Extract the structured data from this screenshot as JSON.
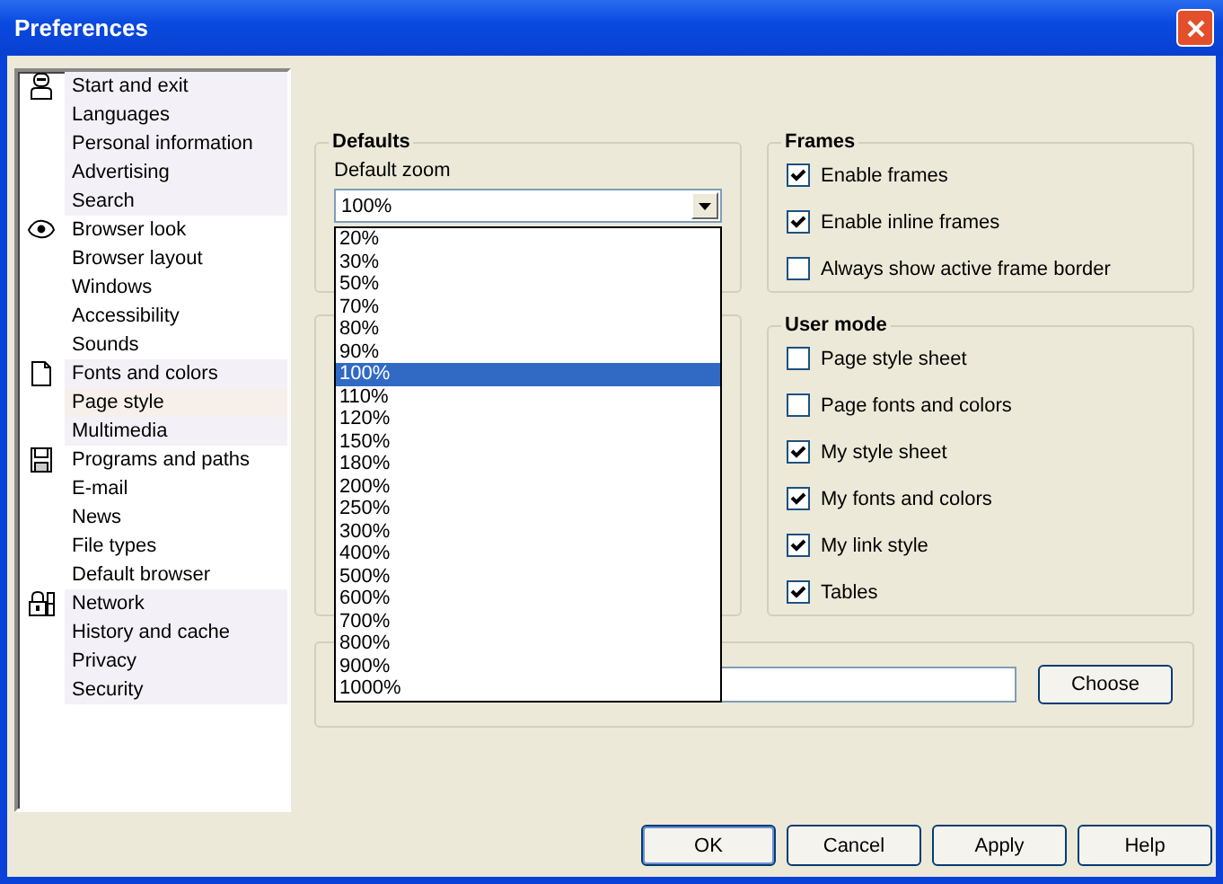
{
  "window": {
    "title": "Preferences"
  },
  "sidebar": {
    "groups": [
      {
        "items": [
          {
            "label": "Start and exit",
            "selected": false
          },
          {
            "label": "Languages",
            "selected": false
          },
          {
            "label": "Personal information",
            "selected": false
          },
          {
            "label": "Advertising",
            "selected": false
          },
          {
            "label": "Search",
            "selected": false
          }
        ]
      },
      {
        "items": [
          {
            "label": "Browser look",
            "selected": false
          },
          {
            "label": "Browser layout",
            "selected": false
          },
          {
            "label": "Windows",
            "selected": false
          },
          {
            "label": "Accessibility",
            "selected": false
          },
          {
            "label": "Sounds",
            "selected": false
          }
        ]
      },
      {
        "items": [
          {
            "label": "Fonts and colors",
            "selected": false
          },
          {
            "label": "Page style",
            "selected": true
          },
          {
            "label": "Multimedia",
            "selected": false
          }
        ]
      },
      {
        "items": [
          {
            "label": "Programs and paths",
            "selected": false
          },
          {
            "label": "E-mail",
            "selected": false
          },
          {
            "label": "News",
            "selected": false
          },
          {
            "label": "File types",
            "selected": false
          },
          {
            "label": "Default browser",
            "selected": false
          }
        ]
      },
      {
        "items": [
          {
            "label": "Network",
            "selected": false
          },
          {
            "label": "History and cache",
            "selected": false
          },
          {
            "label": "Privacy",
            "selected": false
          },
          {
            "label": "Security",
            "selected": false
          }
        ]
      }
    ]
  },
  "defaults": {
    "title": "Defaults",
    "zoom_label": "Default zoom",
    "zoom_value": "100%",
    "expanded": true,
    "options": [
      {
        "label": "20%",
        "selected": false
      },
      {
        "label": "30%",
        "selected": false
      },
      {
        "label": "50%",
        "selected": false
      },
      {
        "label": "70%",
        "selected": false
      },
      {
        "label": "80%",
        "selected": false
      },
      {
        "label": "90%",
        "selected": false
      },
      {
        "label": "100%",
        "selected": true
      },
      {
        "label": "110%",
        "selected": false
      },
      {
        "label": "120%",
        "selected": false
      },
      {
        "label": "150%",
        "selected": false
      },
      {
        "label": "180%",
        "selected": false
      },
      {
        "label": "200%",
        "selected": false
      },
      {
        "label": "250%",
        "selected": false
      },
      {
        "label": "300%",
        "selected": false
      },
      {
        "label": "400%",
        "selected": false
      },
      {
        "label": "500%",
        "selected": false
      },
      {
        "label": "600%",
        "selected": false
      },
      {
        "label": "700%",
        "selected": false
      },
      {
        "label": "800%",
        "selected": false
      },
      {
        "label": "900%",
        "selected": false
      },
      {
        "label": "1000%",
        "selected": false
      }
    ]
  },
  "frames": {
    "title": "Frames",
    "options": [
      {
        "label": "Enable frames",
        "checked": true
      },
      {
        "label": "Enable inline frames",
        "checked": true
      },
      {
        "label": "Always show active frame border",
        "checked": false
      }
    ]
  },
  "user_mode": {
    "title": "User mode",
    "options": [
      {
        "label": "Page style sheet",
        "checked": false
      },
      {
        "label": "Page fonts and colors",
        "checked": false
      },
      {
        "label": "My style sheet",
        "checked": true
      },
      {
        "label": "My fonts and colors",
        "checked": true
      },
      {
        "label": "My link style",
        "checked": true
      },
      {
        "label": "Tables",
        "checked": true
      }
    ]
  },
  "style_sheet": {
    "choose_button": "Choose"
  },
  "buttons": [
    {
      "label": "OK",
      "default": true
    },
    {
      "label": "Cancel",
      "default": false
    },
    {
      "label": "Apply",
      "default": false
    },
    {
      "label": "Help",
      "default": false
    }
  ]
}
